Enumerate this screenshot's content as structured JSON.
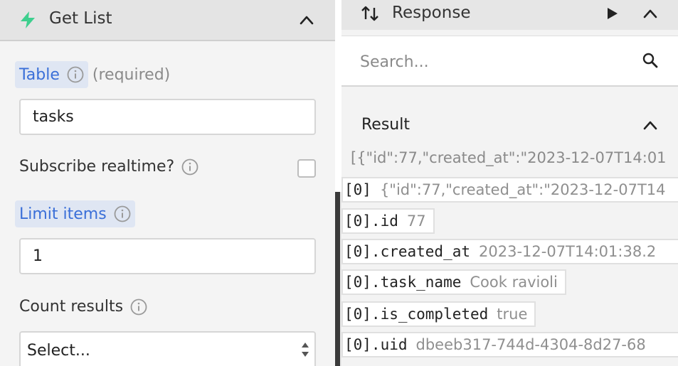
{
  "left_panel": {
    "title": "Get List",
    "table_label": "Table",
    "table_required": "(required)",
    "table_value": "tasks",
    "realtime_label": "Subscribe realtime?",
    "realtime_checked": false,
    "limit_label": "Limit items",
    "limit_value": "1",
    "count_label": "Count results",
    "count_select": "Select..."
  },
  "right_panel": {
    "title": "Response",
    "search_placeholder": "Search...",
    "result_label": "Result",
    "raw_json": "[{\"id\":77,\"created_at\":\"2023-12-07T14:01",
    "rows": [
      {
        "key": "[0]",
        "value": "{\"id\":77,\"created_at\":\"2023-12-07T14"
      },
      {
        "key": "[0].id",
        "value": "77"
      },
      {
        "key": "[0].created_at",
        "value": "2023-12-07T14:01:38.2"
      },
      {
        "key": "[0].task_name",
        "value": "Cook ravioli"
      },
      {
        "key": "[0].is_completed",
        "value": "true"
      },
      {
        "key": "[0].uid",
        "value": "dbeeb317-744d-4304-8d27-68"
      }
    ]
  },
  "colors": {
    "accent_blue": "#3a6fd8",
    "bolt_green": "#3ecf8e",
    "divider": "#3a3a3a"
  },
  "icons": [
    "bolt-icon",
    "chevron-up-icon",
    "info-icon",
    "sort-arrows-icon",
    "play-icon",
    "search-icon",
    "select-arrows-icon"
  ]
}
